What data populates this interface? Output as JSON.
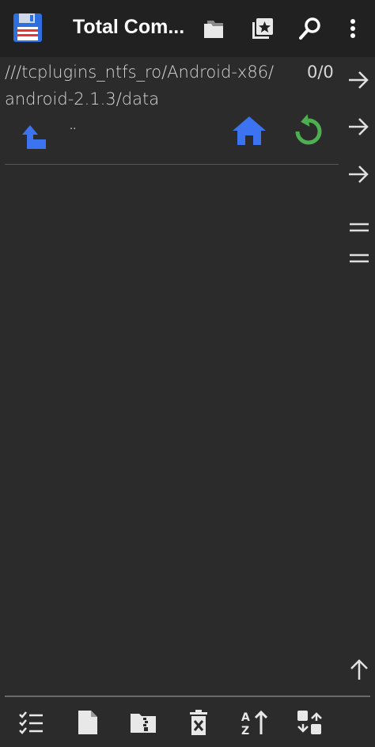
{
  "header": {
    "title": "Total Com...",
    "icons": [
      "save-icon",
      "folder-tabs-icon",
      "bookmarks-icon",
      "search-icon",
      "more-vert-icon"
    ]
  },
  "panel": {
    "path_line1": "///tcplugins_ntfs_ro/Android-x86/",
    "path_line2": "android-2.1.3/data",
    "count": "0/0",
    "parent_label": ".."
  },
  "bottombar": {
    "icons": [
      "select-icon",
      "new-file-icon",
      "zip-folder-icon",
      "delete-icon",
      "sort-icon",
      "swap-panels-icon"
    ]
  },
  "colors": {
    "background": "#2b2b2b",
    "topbar": "#212121",
    "accent_blue": "#3b73f0",
    "accent_green": "#4caf50",
    "text": "#d8d8d8"
  }
}
